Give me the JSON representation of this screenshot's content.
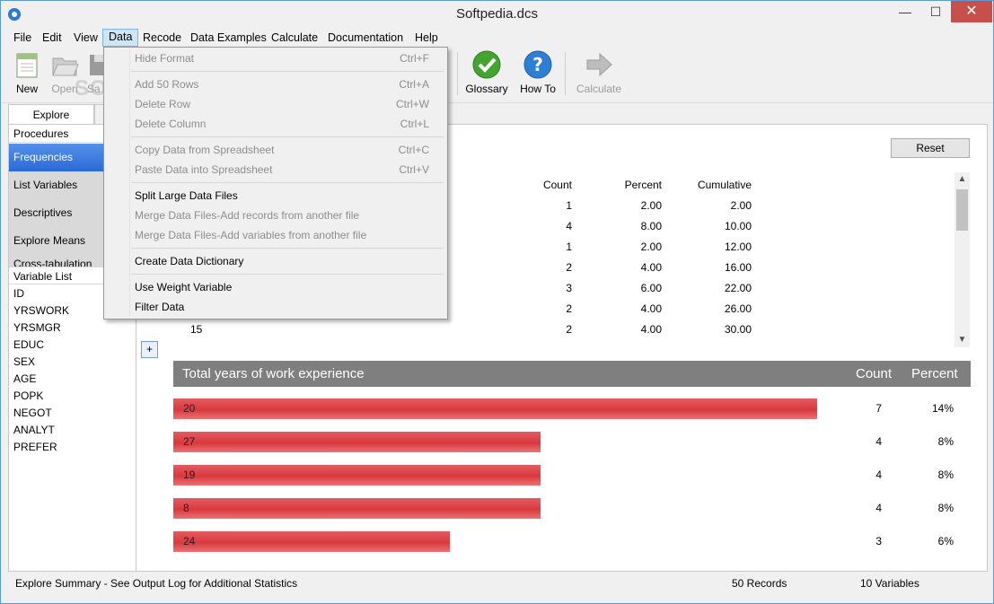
{
  "window": {
    "title": "Softpedia.dcs",
    "minimize": "—",
    "maximize": "☐",
    "close": "✕"
  },
  "menu": [
    "File",
    "Edit",
    "View",
    "Data",
    "Recode",
    "Data Examples",
    "Calculate",
    "Documentation",
    "Help"
  ],
  "toolbar": {
    "new_label": "New",
    "open_label": "Open",
    "save_label": "Sa",
    "glossary_label": "Glossary",
    "howto_label": "How To",
    "calculate_label": "Calculate",
    "watermark": "SOFTPEDIA"
  },
  "left": {
    "tab_explore": "Explore",
    "procedures_header": "Procedures",
    "procedures": [
      "Frequencies",
      "List Variables",
      "Descriptives",
      "Explore Means",
      "Cross-tabulation"
    ],
    "variable_list_header": "Variable List",
    "variables": [
      "ID",
      "YRSWORK",
      "YRSMGR",
      "EDUC",
      "SEX",
      "AGE",
      "POPK",
      "NEGOT",
      "ANALYT",
      "PREFER"
    ]
  },
  "main": {
    "reset_label": "Reset",
    "headers": {
      "count": "Count",
      "percent": "Percent",
      "cumulative": "Cumulative"
    },
    "rows": [
      {
        "value": "",
        "count": "1",
        "percent": "2.00",
        "cumulative": "2.00"
      },
      {
        "value": "",
        "count": "4",
        "percent": "8.00",
        "cumulative": "10.00"
      },
      {
        "value": "",
        "count": "1",
        "percent": "2.00",
        "cumulative": "12.00"
      },
      {
        "value": "",
        "count": "2",
        "percent": "4.00",
        "cumulative": "16.00"
      },
      {
        "value": "",
        "count": "3",
        "percent": "6.00",
        "cumulative": "22.00"
      },
      {
        "value": "",
        "count": "2",
        "percent": "4.00",
        "cumulative": "26.00"
      },
      {
        "value": "15",
        "count": "2",
        "percent": "4.00",
        "cumulative": "30.00"
      }
    ],
    "plus_label": "+",
    "summary_title": "Total years of work experience",
    "summary_count_header": "Count",
    "summary_percent_header": "Percent",
    "bars": [
      {
        "label": "20",
        "count": "7",
        "percent": "14%",
        "fraction": 1.0
      },
      {
        "label": "27",
        "count": "4",
        "percent": "8%",
        "fraction": 0.571
      },
      {
        "label": "19",
        "count": "4",
        "percent": "8%",
        "fraction": 0.571
      },
      {
        "label": "8",
        "count": "4",
        "percent": "8%",
        "fraction": 0.571
      },
      {
        "label": "24",
        "count": "3",
        "percent": "6%",
        "fraction": 0.429
      }
    ],
    "bar_color": "#e05055"
  },
  "status": {
    "summary": "Explore Summary  -  See Output Log for Additional Statistics",
    "records": "50 Records",
    "variables": "10 Variables"
  },
  "dropdown": {
    "items": [
      {
        "label": "Hide Format",
        "shortcut": "Ctrl+F",
        "enabled": false
      },
      {
        "label": "Add 50 Rows",
        "shortcut": "Ctrl+A",
        "enabled": false
      },
      {
        "label": "Delete Row",
        "shortcut": "Ctrl+W",
        "enabled": false
      },
      {
        "label": "Delete Column",
        "shortcut": "Ctrl+L",
        "enabled": false
      },
      {
        "label": "Copy Data from Spreadsheet",
        "shortcut": "Ctrl+C",
        "enabled": false
      },
      {
        "label": "Paste Data into Spreadsheet",
        "shortcut": "Ctrl+V",
        "enabled": false
      },
      {
        "label": "Split Large Data Files",
        "shortcut": "",
        "enabled": true
      },
      {
        "label": "Merge Data Files-Add records from another file",
        "shortcut": "",
        "enabled": false
      },
      {
        "label": "Merge Data Files-Add variables from another file",
        "shortcut": "",
        "enabled": false
      },
      {
        "label": "Create Data Dictionary",
        "shortcut": "",
        "enabled": true
      },
      {
        "label": "Use Weight Variable",
        "shortcut": "",
        "enabled": true
      },
      {
        "label": "Filter Data",
        "shortcut": "",
        "enabled": true
      }
    ]
  }
}
